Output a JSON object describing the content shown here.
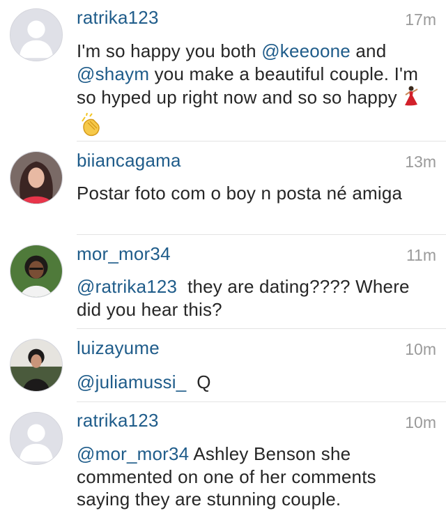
{
  "comments": [
    {
      "username": "ratrika123",
      "time": "17m",
      "avatar": "default-avatar-icon",
      "parts": [
        {
          "t": "I'm so happy you both "
        },
        {
          "m": "@keeoone"
        },
        {
          "t": " and "
        },
        {
          "m": "@shaym"
        },
        {
          "t": " you make a beautiful couple. I'm so hyped up right now and so so happy "
        }
      ],
      "emojis": [
        "dancer-emoji-icon",
        "clapping-hands-emoji-icon"
      ]
    },
    {
      "username": "biiancagama",
      "time": "13m",
      "avatar": "user-photo-avatar",
      "parts": [
        {
          "t": "Postar foto com o boy n posta né amiga"
        }
      ]
    },
    {
      "username": "mor_mor34",
      "time": "11m",
      "avatar": "user-photo-avatar",
      "parts": [
        {
          "m": "@ratrika123"
        },
        {
          "t": "  they are dating???? Where did you hear this?"
        }
      ]
    },
    {
      "username": "luizayume",
      "time": "10m",
      "avatar": "user-photo-avatar",
      "parts": [
        {
          "m": "@juliamussi_"
        },
        {
          "t": "  Q"
        }
      ]
    },
    {
      "username": "ratrika123",
      "time": "10m",
      "avatar": "default-avatar-icon",
      "parts": [
        {
          "m": "@mor_mor34"
        },
        {
          "t": " Ashley Benson she commented on one of her comments saying they are stunning couple."
        }
      ]
    }
  ],
  "colors": {
    "username": "#1f5c8a",
    "mention": "#1f5c8a",
    "time": "#9a9a9a",
    "text": "#262626",
    "separator": "#e3e3e3",
    "default_avatar_bg": "#dfe0e7"
  }
}
